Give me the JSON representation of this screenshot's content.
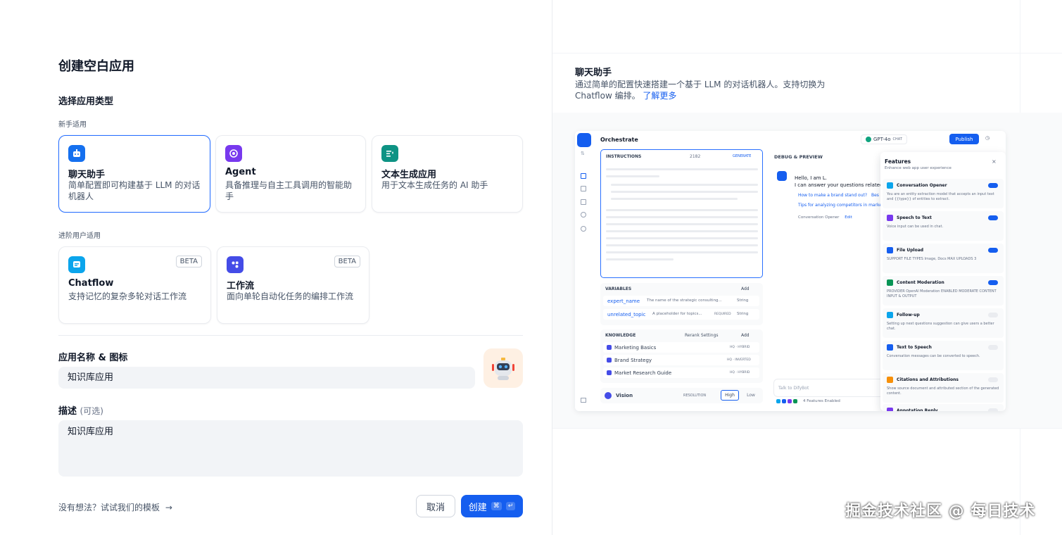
{
  "left": {
    "title": "创建空白应用",
    "select_type_label": "选择应用类型",
    "beginner_label": "新手适用",
    "advanced_label": "进阶用户适用",
    "beginner_cards": [
      {
        "name": "聊天助手",
        "desc": "简单配置即可构建基于 LLM 的对话机器人",
        "icon_color": "#1570ef",
        "selected": true
      },
      {
        "name": "Agent",
        "desc": "具备推理与自主工具调用的智能助手",
        "icon_color": "#7839ee",
        "selected": false
      },
      {
        "name": "文本生成应用",
        "desc": "用于文本生成任务的 AI 助手",
        "icon_color": "#0e9384",
        "selected": false
      }
    ],
    "advanced_cards": [
      {
        "name": "Chatflow",
        "desc": "支持记忆的复杂多轮对话工作流",
        "badge": "BETA",
        "icon_color": "#0ba5ec"
      },
      {
        "name": "工作流",
        "desc": "面向单轮自动化任务的编排工作流",
        "badge": "BETA",
        "icon_color": "#444ce7"
      }
    ],
    "name_label": "应用名称 & 图标",
    "name_value": "知识库应用",
    "desc_label": "描述",
    "desc_optional": "(可选)",
    "desc_value": "知识库应用",
    "template_link": "没有想法？试试我们的模板",
    "cancel_label": "取消",
    "create_label": "创建",
    "create_kbd1": "⌘",
    "create_kbd2": "↵"
  },
  "right": {
    "title": "聊天助手",
    "desc": "通过简单的配置快速搭建一个基于 LLM 的对话机器人。支持切换为 Chatflow 编排。",
    "learn_more": "了解更多",
    "mock": {
      "orchestrate": "Orchestrate",
      "model": "GPT-4o",
      "model_tag": "CHAT",
      "publish": "Publish",
      "instructions": "INSTRUCTIONS",
      "instr_count": "2182",
      "generate": "GENERATE",
      "debug": "DEBUG & PREVIEW",
      "hello1": "Hello, I am L.",
      "hello2": "I can answer your questions related",
      "sugg1": "How to make a brand stand out?",
      "sugg1b": "Bes",
      "sugg2": "Tips for analyzing competitors in marke",
      "conv_opener": "Conversation Opener",
      "edit": "Edit",
      "variables": "VARIABLES",
      "add": "Add",
      "var1_name": "expert_name",
      "var1_desc": "The name of the strategic consulting...",
      "var_type": "String",
      "var2_name": "unrelated_topic",
      "var2_desc": "A placeholder for topics...",
      "required": "REQUIRED",
      "knowledge": "KNOWLEDGE",
      "rerank": "Rerank Settings",
      "kb": [
        {
          "name": "Marketing Basics",
          "tag": "HQ · HYBRID"
        },
        {
          "name": "Brand Strategy",
          "tag": "HQ · INVERTED"
        },
        {
          "name": "Market Research Guide",
          "tag": "HQ · HYBRID"
        }
      ],
      "vision": "Vision",
      "resolution": "RESOLUTION",
      "high": "High",
      "low": "Low",
      "talk_placeholder": "Talk to DifyBot",
      "features_enabled": "4 Features Enabled",
      "features_title": "Features",
      "features_sub": "Enhance web app user experience",
      "features": [
        {
          "name": "Conversation Opener",
          "desc": "You are an entity extraction model that accepts an input text and {{type}} of entities to extract.",
          "on": true,
          "color": "#0ba5ec"
        },
        {
          "name": "Speech to Text",
          "desc": "Voice input can be used in chat.",
          "on": true,
          "color": "#7839ee"
        },
        {
          "name": "File Upload",
          "desc": "SUPPORT FILE TYPES  Image, Docs   MAX UPLOADS 3",
          "on": true,
          "color": "#155eef"
        },
        {
          "name": "Content Moderation",
          "desc": "PROVIDER OpenAI Moderation   ENABLED MODERATE CONTENT INPUT & OUTPUT",
          "on": true,
          "color": "#079455"
        },
        {
          "name": "Follow-up",
          "desc": "Setting up next questions suggestion can give users a better chat.",
          "on": false,
          "color": "#0ba5ec"
        },
        {
          "name": "Text to Speech",
          "desc": "Conversation messages can be converted to speech.",
          "on": false,
          "color": "#155eef"
        },
        {
          "name": "Citations and Attributions",
          "desc": "Show source document and attributed section of the generated content.",
          "on": false,
          "color": "#f79009"
        },
        {
          "name": "Annotation Reply",
          "desc": "",
          "on": false,
          "color": "#7839ee"
        }
      ]
    }
  },
  "watermark": "掘金技术社区 @ 每日技术"
}
